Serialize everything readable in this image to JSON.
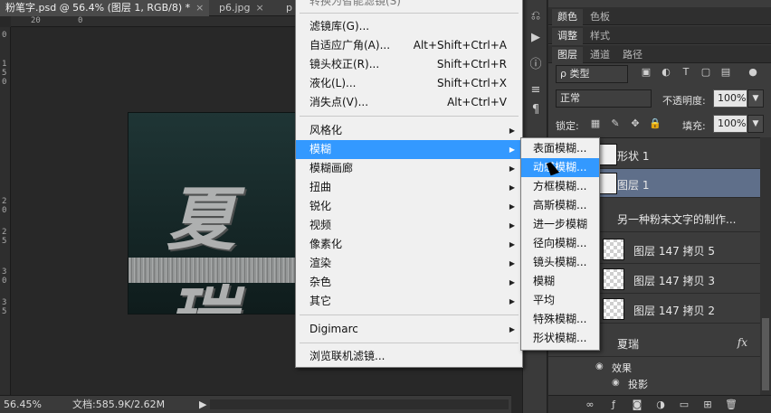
{
  "document_tabs": [
    {
      "label": "粉笔字.psd @ 56.4% (图层 1, RGB/8) *",
      "close": "×",
      "active": true
    },
    {
      "label": "p6.jpg",
      "close": "×",
      "active": false
    },
    {
      "label": "p",
      "close": "",
      "active": false
    }
  ],
  "ruler_top": [
    "20",
    "0"
  ],
  "ruler_left": [
    "0",
    "1",
    "5",
    "0",
    "2",
    "0",
    "2",
    "5",
    "3",
    "0",
    "3",
    "5"
  ],
  "canvas_text": "夏瑞",
  "status": {
    "zoom": "56.45%",
    "doc": "文档:585.9K/2.62M",
    "arrow": "▶"
  },
  "panel_tabs_row1": [
    {
      "label": "颜色",
      "active": true
    },
    {
      "label": "色板",
      "active": false
    }
  ],
  "panel_tabs_row2": [
    {
      "label": "调整",
      "active": true
    },
    {
      "label": "样式",
      "active": false
    }
  ],
  "panel_tabs_row3": [
    {
      "label": "图层",
      "active": true
    },
    {
      "label": "通道",
      "active": false
    },
    {
      "label": "路径",
      "active": false
    }
  ],
  "layers_controls": {
    "filter_kind": "ρ 类型",
    "blend_mode": "正常",
    "opacity_label": "不透明度:",
    "opacity_value": "100%",
    "lock_label": "锁定:",
    "fill_label": "填充:",
    "fill_value": "100%"
  },
  "layers": [
    {
      "name": "形状 1",
      "type": "shape",
      "selected": false
    },
    {
      "name": "图层 1",
      "type": "normal",
      "selected": true
    },
    {
      "name": "另一种粉末文字的制作...",
      "type": "group",
      "selected": false
    },
    {
      "name": "图层 147 拷贝 5",
      "type": "checker",
      "selected": false
    },
    {
      "name": "图层 147 拷贝 3",
      "type": "checker",
      "selected": false
    },
    {
      "name": "图层 147 拷贝 2",
      "type": "checker",
      "selected": false
    },
    {
      "name": "夏瑞",
      "type": "text",
      "selected": false,
      "fx": "fx"
    }
  ],
  "layer_effects": {
    "effects_label": "效果",
    "shadow_label": "投影"
  },
  "filter_menu": {
    "top_cut_label": "转换为智能滤镜(S)",
    "items": [
      {
        "label": "滤镜库(G)...",
        "shortcut": "",
        "submenu": false
      },
      {
        "label": "自适应广角(A)...",
        "shortcut": "Alt+Shift+Ctrl+A",
        "submenu": false
      },
      {
        "label": "镜头校正(R)...",
        "shortcut": "Shift+Ctrl+R",
        "submenu": false
      },
      {
        "label": "液化(L)...",
        "shortcut": "Shift+Ctrl+X",
        "submenu": false
      },
      {
        "label": "消失点(V)...",
        "shortcut": "Alt+Ctrl+V",
        "submenu": false
      },
      {
        "label": "风格化",
        "shortcut": "",
        "submenu": true
      },
      {
        "label": "模糊",
        "shortcut": "",
        "submenu": true
      },
      {
        "label": "模糊画廊",
        "shortcut": "",
        "submenu": true
      },
      {
        "label": "扭曲",
        "shortcut": "",
        "submenu": true
      },
      {
        "label": "锐化",
        "shortcut": "",
        "submenu": true
      },
      {
        "label": "视频",
        "shortcut": "",
        "submenu": true
      },
      {
        "label": "像素化",
        "shortcut": "",
        "submenu": true
      },
      {
        "label": "渲染",
        "shortcut": "",
        "submenu": true
      },
      {
        "label": "杂色",
        "shortcut": "",
        "submenu": true
      },
      {
        "label": "其它",
        "shortcut": "",
        "submenu": true
      },
      {
        "label": "Digimarc",
        "shortcut": "",
        "submenu": true
      },
      {
        "label": "浏览联机滤镜...",
        "shortcut": "",
        "submenu": false
      }
    ]
  },
  "blur_submenu": {
    "items": [
      "表面模糊...",
      "动感模糊...",
      "方框模糊...",
      "高斯模糊...",
      "进一步模糊",
      "径向模糊...",
      "镜头模糊...",
      "模糊",
      "平均",
      "特殊模糊...",
      "形状模糊..."
    ]
  },
  "colors": {
    "menu_highlight": "#3399ff",
    "selected_layer": "#5f6f8a"
  }
}
